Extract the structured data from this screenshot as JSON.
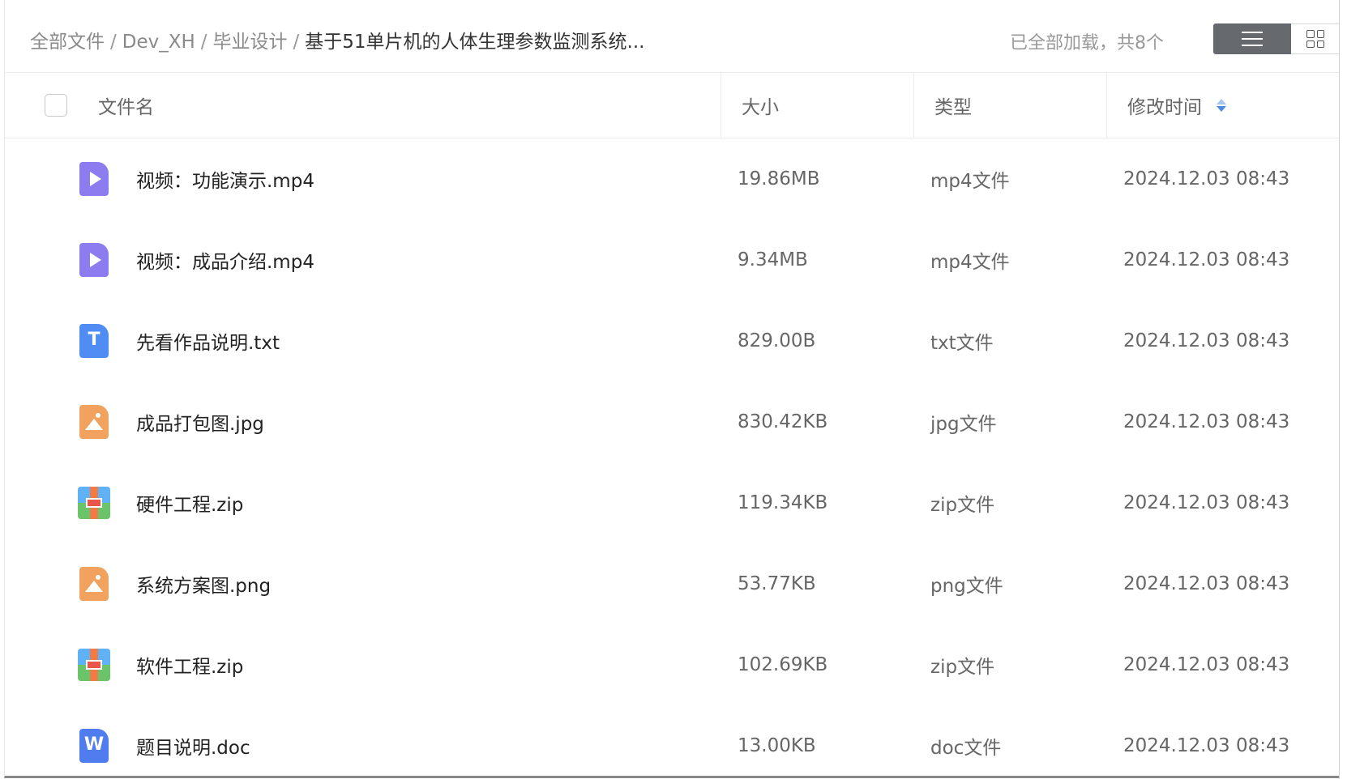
{
  "breadcrumb": {
    "items": [
      "全部文件",
      "Dev_XH",
      "毕业设计"
    ],
    "separator": "/",
    "current": "基于51单片机的人体生理参数监测系统..."
  },
  "status": {
    "loaded_text": "已全部加载，共8个"
  },
  "view": {
    "selected": "list"
  },
  "table": {
    "headers": {
      "name": "文件名",
      "size": "大小",
      "type": "类型",
      "mtime": "修改时间"
    },
    "sort": {
      "column": "mtime",
      "direction": "desc"
    },
    "rows": [
      {
        "icon": "video-file-icon",
        "name": "视频：功能演示.mp4",
        "size": "19.86MB",
        "type": "mp4文件",
        "mtime": "2024.12.03 08:43"
      },
      {
        "icon": "video-file-icon",
        "name": "视频：成品介绍.mp4",
        "size": "9.34MB",
        "type": "mp4文件",
        "mtime": "2024.12.03 08:43"
      },
      {
        "icon": "text-file-icon",
        "name": "先看作品说明.txt",
        "size": "829.00B",
        "type": "txt文件",
        "mtime": "2024.12.03 08:43"
      },
      {
        "icon": "image-file-icon",
        "name": "成品打包图.jpg",
        "size": "830.42KB",
        "type": "jpg文件",
        "mtime": "2024.12.03 08:43"
      },
      {
        "icon": "zip-file-icon",
        "name": "硬件工程.zip",
        "size": "119.34KB",
        "type": "zip文件",
        "mtime": "2024.12.03 08:43"
      },
      {
        "icon": "image-file-icon",
        "name": "系统方案图.png",
        "size": "53.77KB",
        "type": "png文件",
        "mtime": "2024.12.03 08:43"
      },
      {
        "icon": "zip-file-icon",
        "name": "软件工程.zip",
        "size": "102.69KB",
        "type": "zip文件",
        "mtime": "2024.12.03 08:43"
      },
      {
        "icon": "word-file-icon",
        "name": "题目说明.doc",
        "size": "13.00KB",
        "type": "doc文件",
        "mtime": "2024.12.03 08:43"
      }
    ]
  },
  "colors": {
    "video": "#8c7cf0",
    "text": "#4f8cf3",
    "image": "#f0a25e",
    "zip_top": "#5fb2f5",
    "zip_bottom": "#6cc46a",
    "word": "#4f7df0",
    "sort_active": "#4a8be8"
  }
}
